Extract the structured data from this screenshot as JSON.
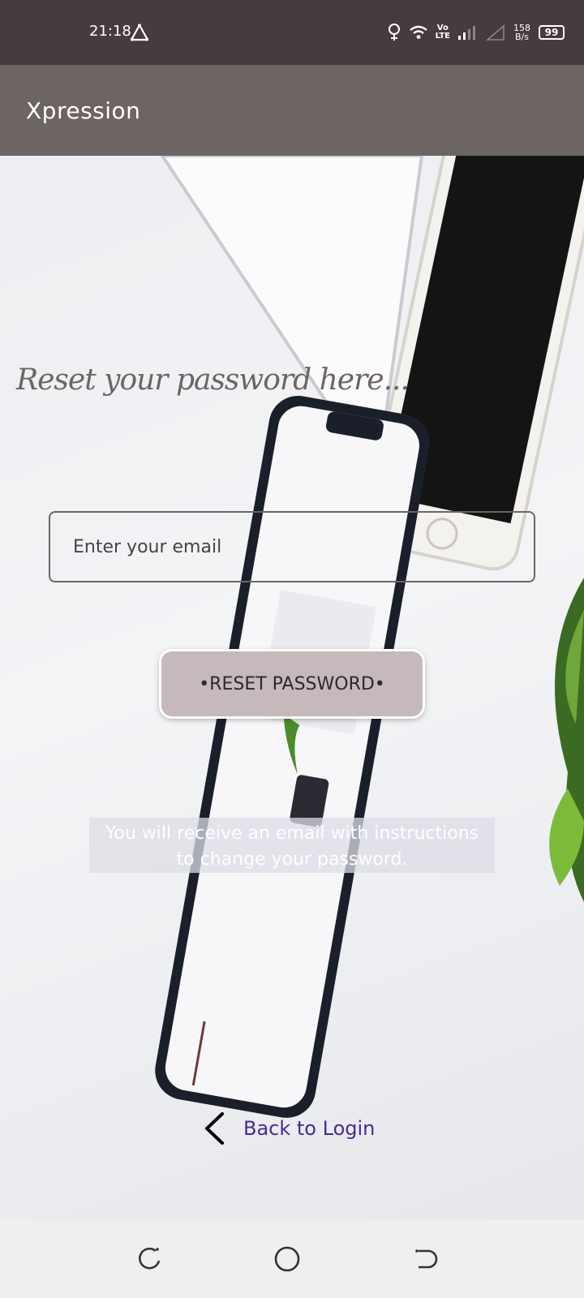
{
  "status_bar": {
    "time": "21:18",
    "net_speed_value": "158",
    "net_speed_unit": "B/s",
    "volte_top": "Vo",
    "volte_bottom": "LTE",
    "battery": "99"
  },
  "app_bar": {
    "title": "Xpression"
  },
  "main": {
    "heading": "Reset your password here...",
    "email_placeholder": "Enter your email",
    "reset_button": "•RESET PASSWORD•",
    "info_line1": "You will receive an email with instructions",
    "info_line2": "to change your password.",
    "back_label": "Back to Login"
  },
  "icons": {
    "alert": "triangle-alert-icon",
    "location": "location-icon",
    "wifi": "wifi-icon",
    "signal": "signal-icon",
    "back": "chevron-left-icon",
    "nav_recent": "recent-apps-icon",
    "nav_home": "home-circle-icon",
    "nav_back": "back-nav-icon"
  },
  "colors": {
    "status_bar": "#463b3e",
    "app_bar": "#6d6464",
    "button": "#c5b9bc",
    "link": "#4b2a8f"
  }
}
